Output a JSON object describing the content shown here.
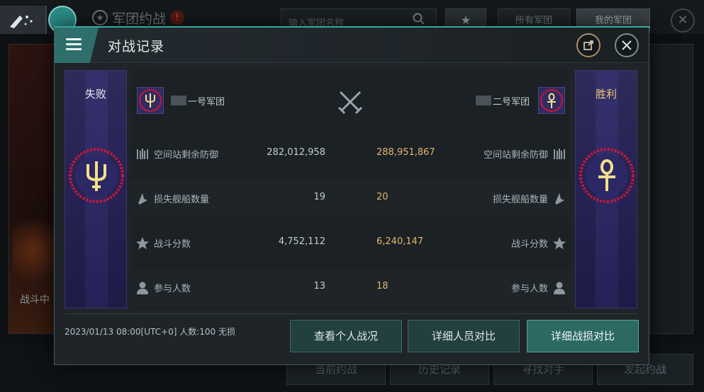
{
  "background": {
    "title": "军团约战",
    "search_placeholder": "输入军团名称",
    "tabs": [
      "所有军团",
      "我的军团"
    ],
    "left_panel_text": "战斗中",
    "bottom_buttons": [
      "当前约战",
      "历史记录",
      "寻找对手",
      "发起约战"
    ]
  },
  "modal": {
    "title": "对战记录",
    "left_result": "失败",
    "right_result": "胜利",
    "left_team": "一号军团",
    "right_team": "二号军团",
    "stats": [
      {
        "icon": "station-icon",
        "label": "空间站剩余防御",
        "left": "282,012,958",
        "right": "288,951,867"
      },
      {
        "icon": "ship-loss-icon",
        "label": "损失舰船数量",
        "left": "19",
        "right": "20"
      },
      {
        "icon": "star-icon",
        "label": "战斗分数",
        "left": "4,752,112",
        "right": "6,240,147"
      },
      {
        "icon": "person-icon",
        "label": "参与人数",
        "left": "13",
        "right": "18"
      }
    ],
    "footer_info": "2023/01/13 08:00[UTC+0] 人数:100 无损",
    "buttons": {
      "personal": "查看个人战况",
      "members": "详细人员对比",
      "losses": "详细战损对比"
    }
  },
  "colors": {
    "accent": "#2e6f6b",
    "gold": "#e2b76a",
    "banner": "#2e2a5a",
    "emblem_red": "#c8143c"
  }
}
